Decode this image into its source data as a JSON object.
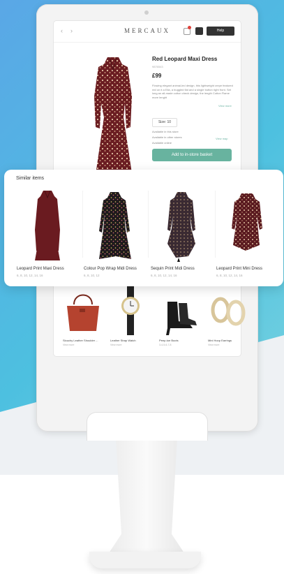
{
  "header": {
    "logo": "MERCAUX",
    "back_label": "‹",
    "forward_label": "›",
    "help_label": "Help"
  },
  "product": {
    "title": "Red Leopard Maxi Dress",
    "code": "9876543",
    "price": "£99",
    "description": "Flowing elegant animal-led design, this lightweight crepe featured red on it a Ella, a buggled flat and a single button right front. Set long an all-made cotton check design, the length Cotton Flame more lenght",
    "more_label": "View more",
    "size_label": "Size: 10",
    "availability": [
      "Available in this store",
      "Available in other stores",
      "Available online"
    ],
    "view_map_label": "View map",
    "add_button_label": "Add to in-store basket"
  },
  "similar": {
    "title": "Similar items",
    "items": [
      {
        "name": "Leopard Print Maxi Dress",
        "sizes": "6, 8, 10, 12, 14, 16"
      },
      {
        "name": "Colour Pop Wrap Midi Dress",
        "sizes": "6, 8, 10, 12"
      },
      {
        "name": "Sequin Print Midi Dress",
        "sizes": "6, 8, 10, 12, 14, 16"
      },
      {
        "name": "Leopard Print Mini Dress",
        "sizes": "6, 8, 10, 12, 14, 16"
      }
    ]
  },
  "accessories": [
    {
      "name": "Slouchy Leather Shoulder ...",
      "sub": "View more"
    },
    {
      "name": "Leather Strap Watch",
      "sub": "View more"
    },
    {
      "name": "Peep-toe Boots",
      "sub": "3-4-5-6-7-8"
    },
    {
      "name": "Mini Hoop Earrings",
      "sub": "View more"
    }
  ],
  "colors": {
    "accent": "#68b39f",
    "badge": "#e0413a",
    "dress_red": "#6b1d22"
  },
  "icons": {
    "basket": "basket-icon",
    "menu": "menu-icon",
    "check": "check-icon"
  }
}
